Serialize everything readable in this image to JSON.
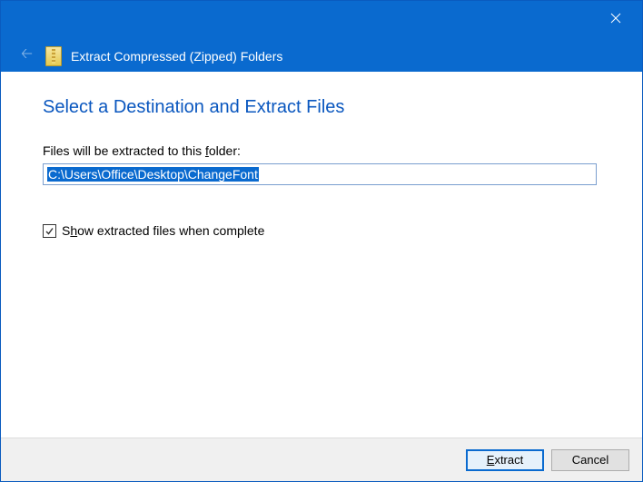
{
  "titlebar": {
    "title": "Extract Compressed (Zipped) Folders"
  },
  "content": {
    "heading": "Select a Destination and Extract Files",
    "folder_label_pre": "Files will be extracted to this ",
    "folder_label_hotkey": "f",
    "folder_label_post": "older:",
    "path_value": "C:\\Users\\Office\\Desktop\\ChangeFont",
    "checkbox_pre": "S",
    "checkbox_hotkey": "h",
    "checkbox_post": "ow extracted files when complete",
    "checkbox_checked": true
  },
  "footer": {
    "extract_pre": "",
    "extract_hotkey": "E",
    "extract_post": "xtract",
    "cancel_label": "Cancel"
  }
}
